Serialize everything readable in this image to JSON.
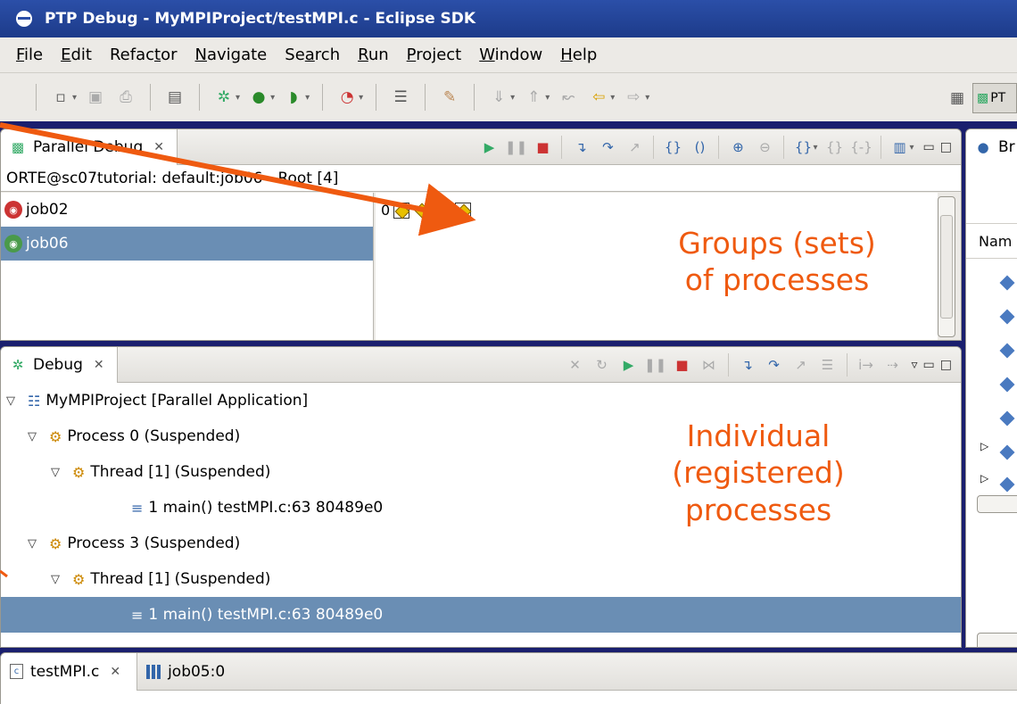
{
  "window": {
    "title": "PTP Debug - MyMPIProject/testMPI.c - Eclipse SDK",
    "colors": {
      "annotation": "#ef5a10",
      "selection": "#6a8eb4",
      "titlebar": "#2b4fa8"
    }
  },
  "menu": {
    "items": [
      {
        "label": "File",
        "mnemonic": "F"
      },
      {
        "label": "Edit",
        "mnemonic": "E"
      },
      {
        "label": "Refactor",
        "mnemonic": "t"
      },
      {
        "label": "Navigate",
        "mnemonic": "N"
      },
      {
        "label": "Search",
        "mnemonic": "a"
      },
      {
        "label": "Run",
        "mnemonic": "R"
      },
      {
        "label": "Project",
        "mnemonic": "P"
      },
      {
        "label": "Window",
        "mnemonic": "W"
      },
      {
        "label": "Help",
        "mnemonic": "H"
      }
    ]
  },
  "perspective": {
    "label": "PT"
  },
  "parallel_debug": {
    "tab_label": "Parallel Debug",
    "path": "ORTE@sc07tutorial: default:job06 - Root [4]",
    "jobs": [
      {
        "label": "job02",
        "selected": false
      },
      {
        "label": "job06",
        "selected": true
      }
    ],
    "process_row_index": "0",
    "annotation": {
      "line1": "Groups (sets)",
      "line2": "of processes"
    }
  },
  "debug": {
    "tab_label": "Debug",
    "tree": [
      {
        "label": "MyMPIProject [Parallel Application]"
      },
      {
        "label": "Process 0 (Suspended)"
      },
      {
        "label": "Thread [1] (Suspended)"
      },
      {
        "label": "1 main() testMPI.c:63 80489e0"
      },
      {
        "label": "Process 3 (Suspended)"
      },
      {
        "label": "Thread [1] (Suspended)"
      },
      {
        "label": "1 main() testMPI.c:63 80489e0"
      }
    ],
    "annotation": {
      "line1": "Individual",
      "line2": "(registered)",
      "line3": "processes"
    }
  },
  "breakpoints": {
    "tab_label": "Br",
    "column_header": "Nam"
  },
  "editor": {
    "tabs": [
      {
        "label": "testMPI.c",
        "active": true
      },
      {
        "label": "job05:0",
        "active": false
      }
    ]
  }
}
